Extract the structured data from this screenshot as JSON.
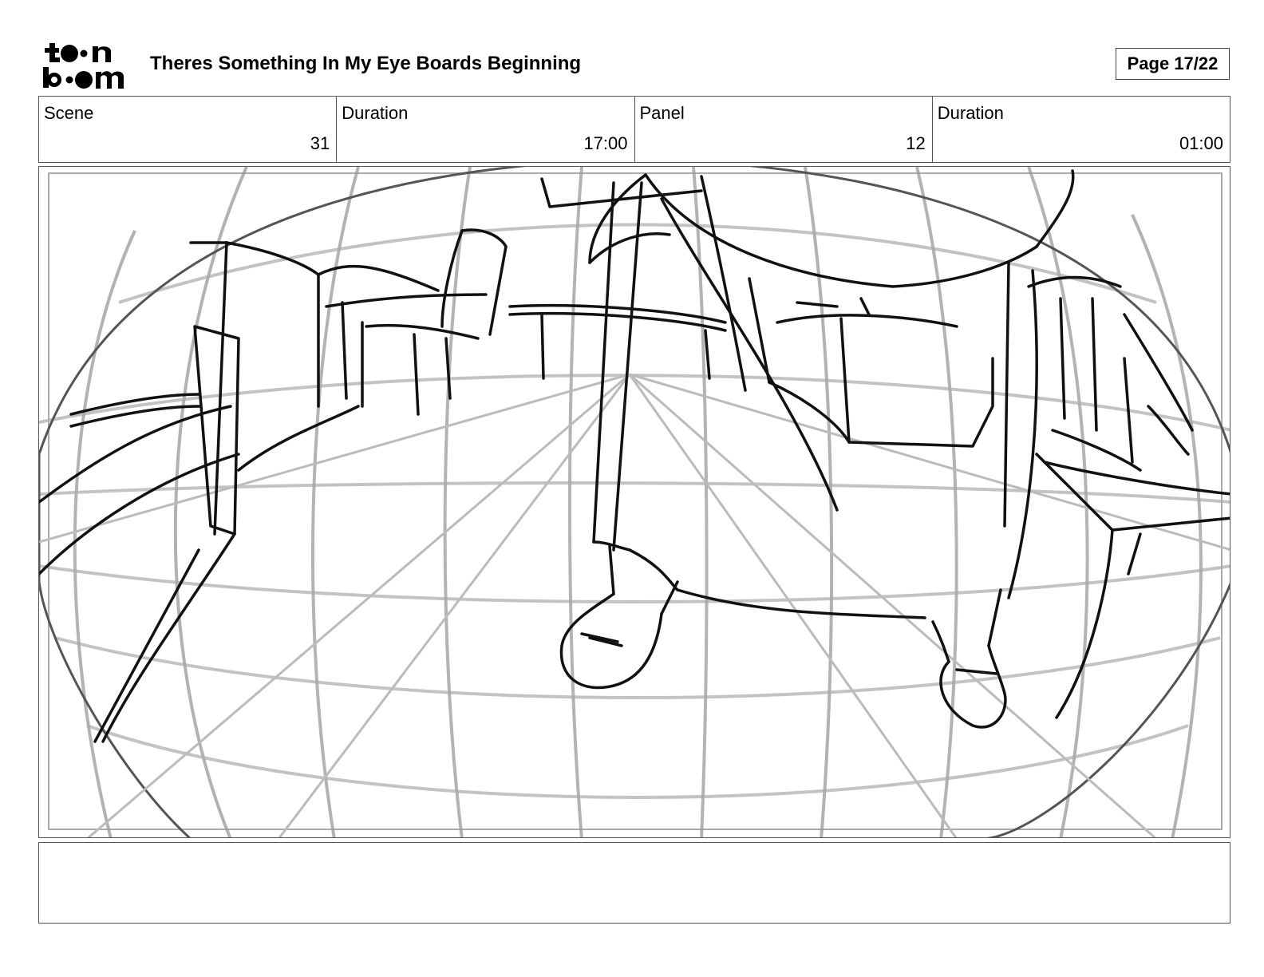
{
  "header": {
    "logo": {
      "icon": "toon-boom-logo",
      "line1": "toon",
      "line2": "boom"
    },
    "title": "Theres Something In My Eye Boards Beginning",
    "page_label": "Page 17/22"
  },
  "info": {
    "scene_label": "Scene",
    "scene_value": "31",
    "scene_duration_label": "Duration",
    "scene_duration_value": "17:00",
    "panel_label": "Panel",
    "panel_value": "12",
    "panel_duration_label": "Duration",
    "panel_duration_value": "01:00"
  },
  "panel": {
    "image": "fisheye-sketch-icon"
  },
  "notes": {
    "text": ""
  }
}
